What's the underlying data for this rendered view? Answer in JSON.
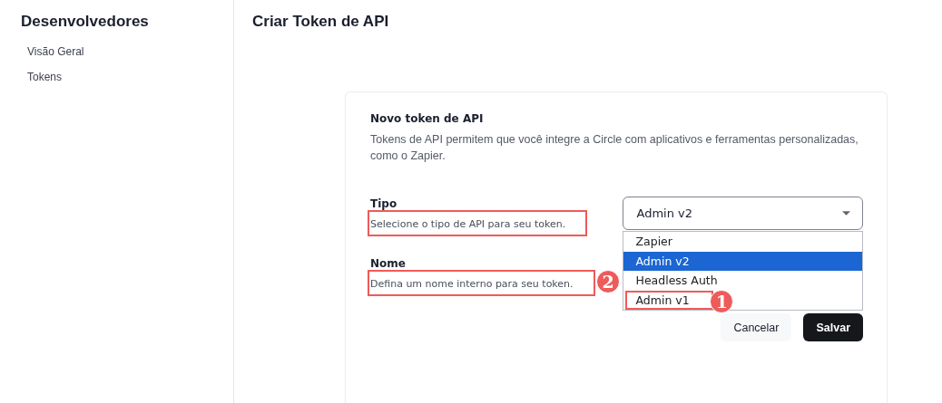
{
  "sidebar": {
    "title": "Desenvolvedores",
    "items": [
      {
        "label": "Visão Geral"
      },
      {
        "label": "Tokens"
      }
    ]
  },
  "page_title": "Criar Token de API",
  "card": {
    "title": "Novo token de API",
    "description": "Tokens de API permitem que você integre a Circle com aplicativos e ferramentas personalizadas, como o Zapier.",
    "fields": [
      {
        "label": "Tipo",
        "hint": "Selecione o tipo de API para seu token.",
        "highlighted": true,
        "kind": "select",
        "value": "Admin v2",
        "expanded": true,
        "options": [
          {
            "label": "Zapier",
            "selected": false,
            "highlighted": false
          },
          {
            "label": "Admin v2",
            "selected": true,
            "highlighted": false
          },
          {
            "label": "Headless Auth",
            "selected": false,
            "highlighted": false
          },
          {
            "label": "Admin v1",
            "selected": false,
            "highlighted": true,
            "badge": "1"
          }
        ]
      },
      {
        "label": "Nome",
        "hint": "Defina um nome interno para seu token.",
        "highlighted": true,
        "badge": "2",
        "kind": "text"
      }
    ],
    "buttons": [
      {
        "label": "Cancelar",
        "kind": "secondary"
      },
      {
        "label": "Salvar",
        "kind": "primary"
      }
    ]
  }
}
